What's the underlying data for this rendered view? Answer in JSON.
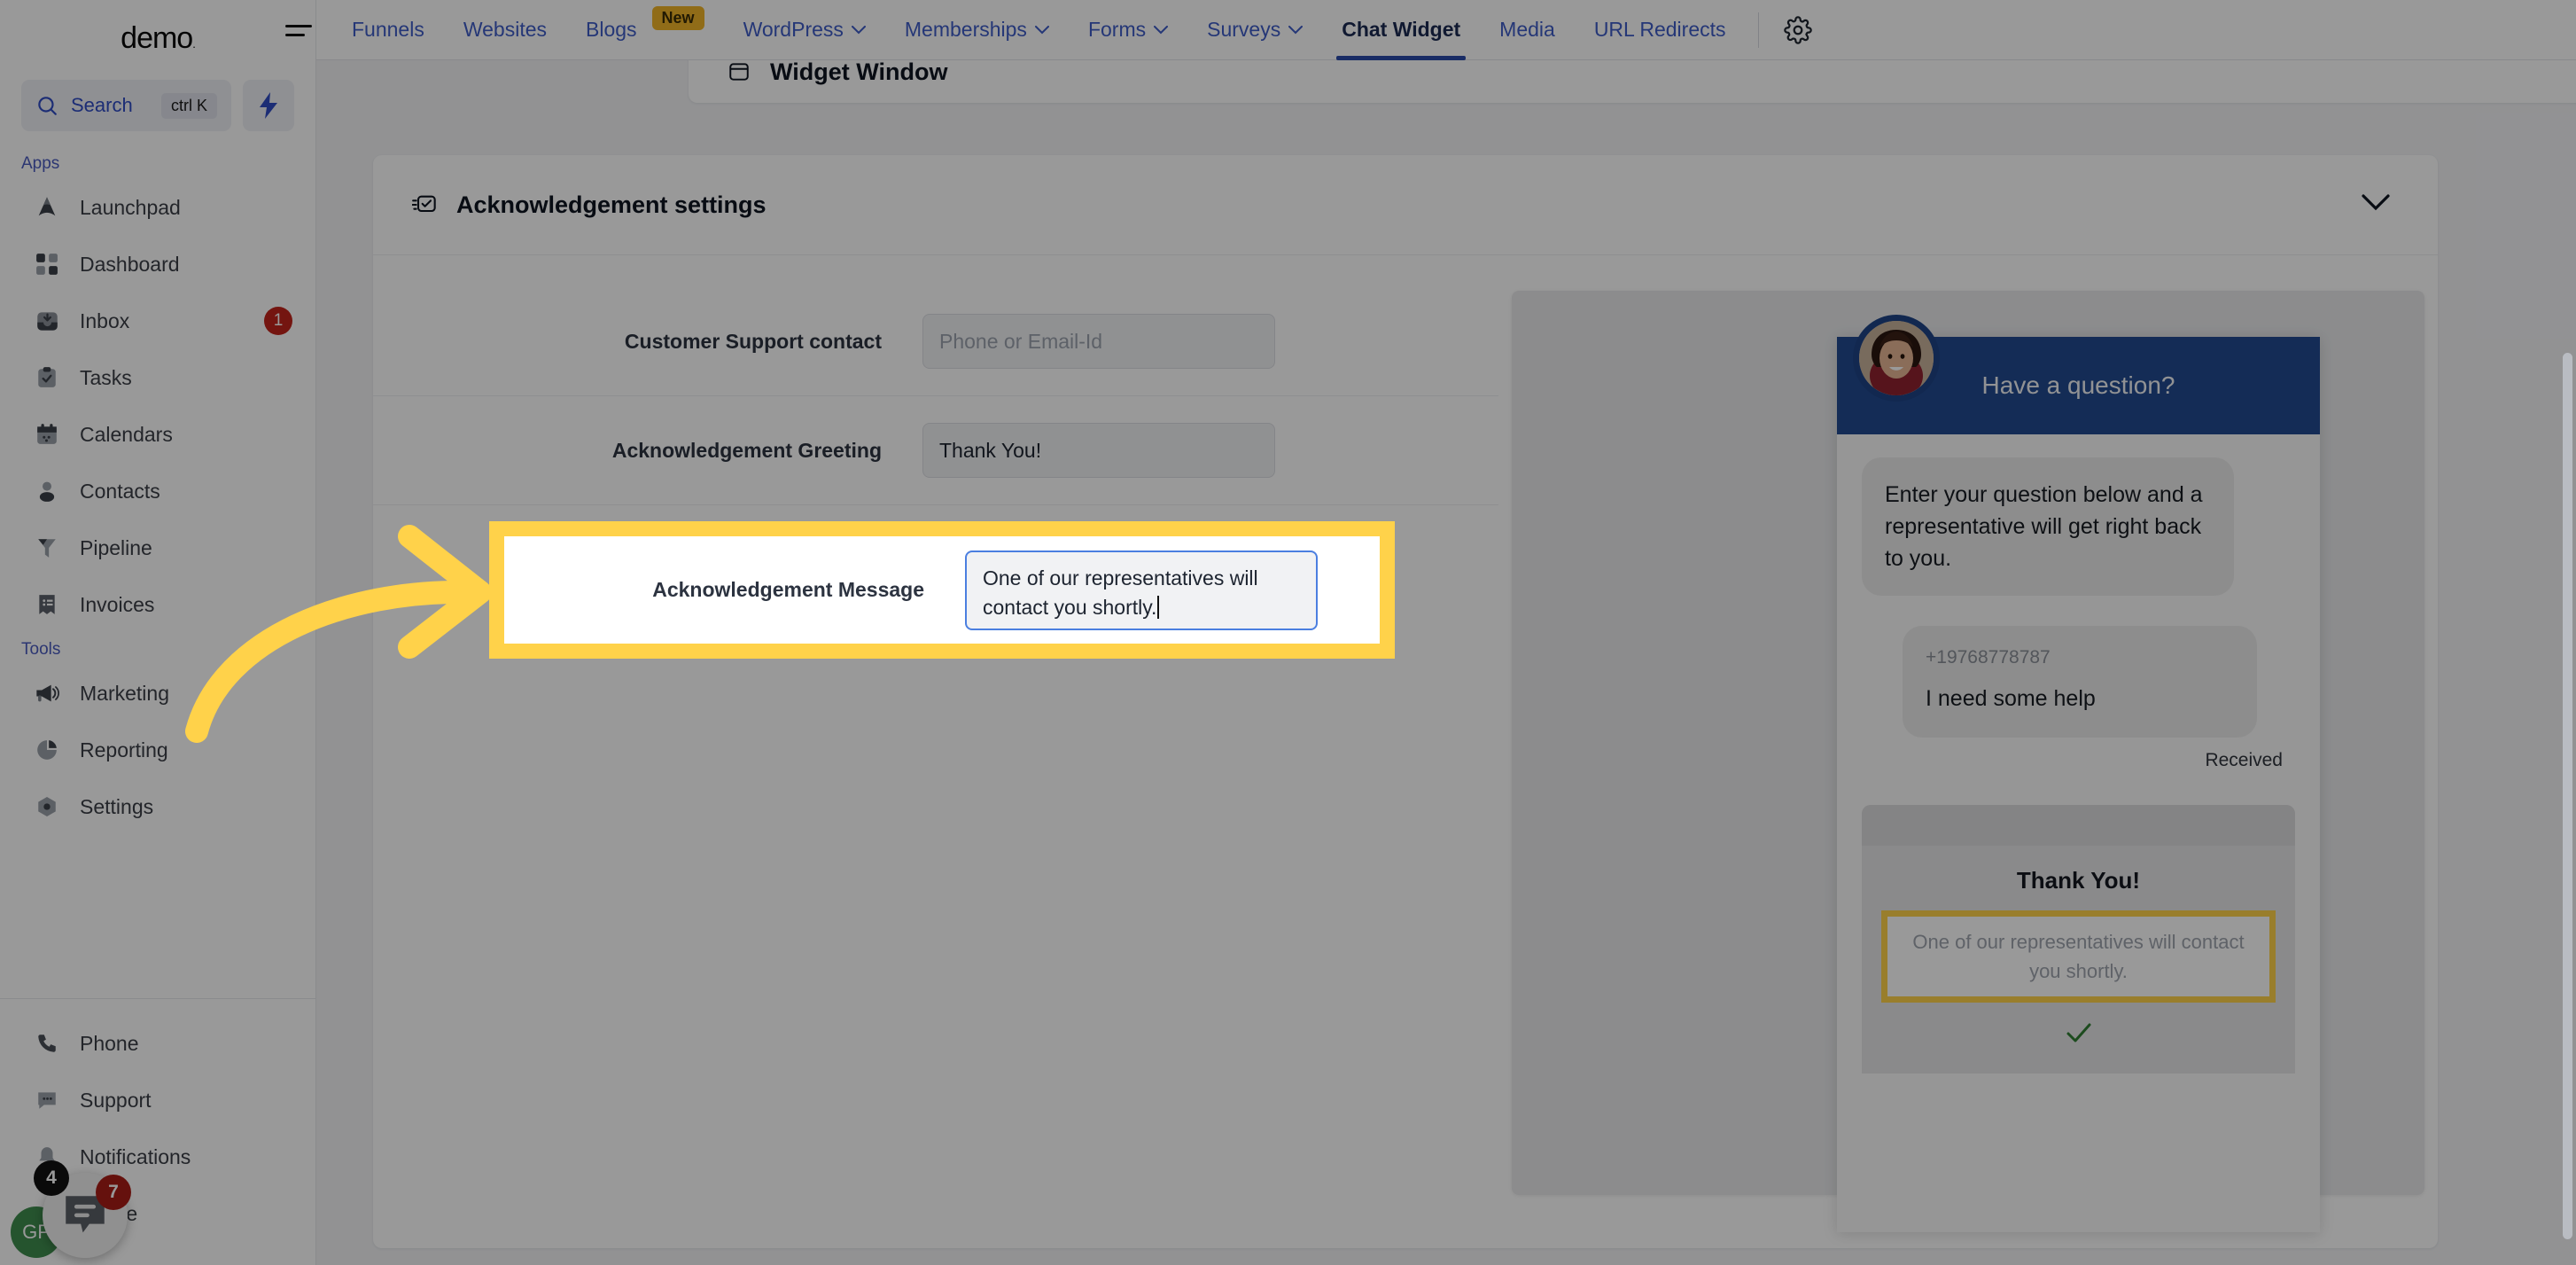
{
  "sidebar": {
    "brand": "demo",
    "brand_mark": ".",
    "search": {
      "label": "Search",
      "shortcut": "ctrl K",
      "icon": "search-icon"
    },
    "bolt_icon": "lightning-bolt-icon",
    "sections": [
      {
        "label": "Apps",
        "items": [
          {
            "label": "Launchpad",
            "icon": "rocket-icon",
            "badge": ""
          },
          {
            "label": "Dashboard",
            "icon": "grid-icon",
            "badge": ""
          },
          {
            "label": "Inbox",
            "icon": "inbox-icon",
            "badge": "1"
          },
          {
            "label": "Tasks",
            "icon": "clipboard-check-icon",
            "badge": ""
          },
          {
            "label": "Calendars",
            "icon": "calendar-icon",
            "badge": ""
          },
          {
            "label": "Contacts",
            "icon": "person-icon",
            "badge": ""
          },
          {
            "label": "Pipeline",
            "icon": "funnel-icon",
            "badge": ""
          },
          {
            "label": "Invoices",
            "icon": "invoice-icon",
            "badge": ""
          }
        ]
      },
      {
        "label": "Tools",
        "items": [
          {
            "label": "Marketing",
            "icon": "megaphone-icon",
            "badge": ""
          },
          {
            "label": "Reporting",
            "icon": "pie-chart-icon",
            "badge": ""
          },
          {
            "label": "Settings",
            "icon": "gear-hex-icon",
            "badge": ""
          }
        ]
      }
    ],
    "bottom_items": [
      {
        "label": "Phone",
        "icon": "phone-icon",
        "badge": ""
      },
      {
        "label": "Support",
        "icon": "chat-dots-icon",
        "badge": ""
      },
      {
        "label": "Notifications",
        "icon": "bell-icon",
        "badge": "4"
      },
      {
        "label": "Profile",
        "icon": "avatar-icon",
        "badge": ""
      }
    ],
    "profile_initials": "GP",
    "launcher": {
      "icon": "chat-bubble-icon",
      "badge": "7"
    }
  },
  "topnav": {
    "hamburger_icon": "hamburger-menu-icon",
    "items": [
      {
        "label": "Funnels",
        "caret": false,
        "badge": "",
        "active": false
      },
      {
        "label": "Websites",
        "caret": false,
        "badge": "",
        "active": false
      },
      {
        "label": "Blogs",
        "caret": false,
        "badge": "New",
        "active": false
      },
      {
        "label": "WordPress",
        "caret": true,
        "badge": "",
        "active": false
      },
      {
        "label": "Memberships",
        "caret": true,
        "badge": "",
        "active": false
      },
      {
        "label": "Forms",
        "caret": true,
        "badge": "",
        "active": false
      },
      {
        "label": "Surveys",
        "caret": true,
        "badge": "",
        "active": false
      },
      {
        "label": "Chat Widget",
        "caret": false,
        "badge": "",
        "active": true
      },
      {
        "label": "Media",
        "caret": false,
        "badge": "",
        "active": false
      },
      {
        "label": "URL Redirects",
        "caret": false,
        "badge": "",
        "active": false
      }
    ],
    "gear_icon": "gear-icon"
  },
  "main": {
    "collapsed_section": {
      "title": "Widget Window",
      "icon": "window-icon",
      "chevron": "chevron-down-icon"
    },
    "section": {
      "title": "Acknowledgement settings",
      "icon": "message-check-icon",
      "chevron": "chevron-down-icon"
    },
    "fields": [
      {
        "label": "Customer Support contact",
        "value": "",
        "placeholder": "Phone or Email-Id",
        "type": "text"
      },
      {
        "label": "Acknowledgement Greeting",
        "value": "Thank You!",
        "placeholder": "",
        "type": "text"
      },
      {
        "label": "Acknowledgement Message",
        "value": "One of our representatives will contact you shortly.",
        "placeholder": "",
        "type": "textarea"
      }
    ]
  },
  "preview": {
    "header_title": "Have a question?",
    "avatar_icon": "agent-avatar-icon",
    "intro_message": "Enter your question below and a representative will get right back to you.",
    "inbound": {
      "phone": "+19768778787",
      "text": "I need some help",
      "status": "Received"
    },
    "acknowledgement": {
      "title": "Thank You!",
      "message": "One of our representatives will contact you shortly.",
      "check_icon": "check-icon"
    }
  },
  "annotation": {
    "arrow_icon": "curved-arrow-right-icon",
    "highlight_color": "#ffd24a"
  },
  "colors": {
    "accent_blue": "#2b4aa8",
    "link_blue": "#3e5cc6",
    "widget_header": "#224a8f",
    "badge_red": "#c2241b",
    "highlight_yellow": "#ffd24a",
    "new_badge": "#f0b429"
  }
}
